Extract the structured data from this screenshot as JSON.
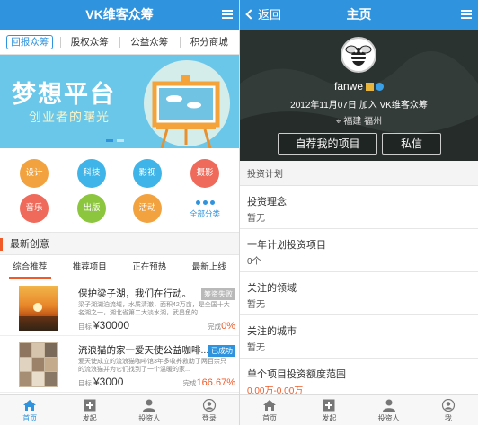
{
  "left": {
    "header_title": "VK维客众筹",
    "category_tabs": [
      "回报众筹",
      "股权众筹",
      "公益众筹",
      "积分商城"
    ],
    "banner": {
      "title": "梦想平台",
      "subtitle": "创业者的曙光"
    },
    "categories": [
      {
        "label": "设计",
        "color": "#f2a340"
      },
      {
        "label": "科技",
        "color": "#3fb4e8"
      },
      {
        "label": "影视",
        "color": "#3fb4e8"
      },
      {
        "label": "摄影",
        "color": "#ef6a5a"
      },
      {
        "label": "音乐",
        "color": "#ef6a5a"
      },
      {
        "label": "出版",
        "color": "#8cc63e"
      },
      {
        "label": "活动",
        "color": "#f2a340"
      }
    ],
    "all_categories_label": "全部分类",
    "section_title": "最新创意",
    "sort_tabs": [
      "综合推荐",
      "推荐项目",
      "正在预热",
      "最新上线"
    ],
    "projects": [
      {
        "name": "保护梁子湖，我们在行动。",
        "badge": "筹资失败",
        "badge_color": "#b9b9b9",
        "desc": "梁子湖湖泊流域，水质清澈，面积42万亩，是全国十大名湖之一，湖北省第二大淡水湖，武昌鱼的...",
        "goal_label": "目标",
        "goal": "¥30000",
        "done_label": "完成",
        "done": "0%"
      },
      {
        "name": "流浪猫的家一爱天使公益咖啡...",
        "badge": "已成功",
        "badge_color": "#2f93dd",
        "desc": "爱天使成立的流浪猫咖啡馆3年多收养救助了两百余只的流浪猫并为它们找到了一个温暖的家...",
        "goal_label": "目标",
        "goal": "¥3000",
        "done_label": "完成",
        "done": "166.67%"
      }
    ],
    "nav": [
      "首页",
      "发起",
      "投资人",
      "登录"
    ]
  },
  "right": {
    "back_label": "返回",
    "header_title": "主页",
    "username": "fanwe",
    "joined": "2012年11月07日 加入 VK维客众筹",
    "location": "福建 福州",
    "btn_self_projects": "自荐我的项目",
    "btn_message": "私信",
    "plan_title": "投资计划",
    "rows": [
      {
        "key": "投资理念",
        "value": "暂无"
      },
      {
        "key": "一年计划投资项目",
        "value": "0个"
      },
      {
        "key": "关注的领域",
        "value": "暂无"
      },
      {
        "key": "关注的城市",
        "value": "暂无"
      },
      {
        "key": "单个项目投资额度范围",
        "value": "0.00万-0.00万"
      }
    ],
    "nav": [
      "首页",
      "发起",
      "投资人",
      "我"
    ]
  }
}
